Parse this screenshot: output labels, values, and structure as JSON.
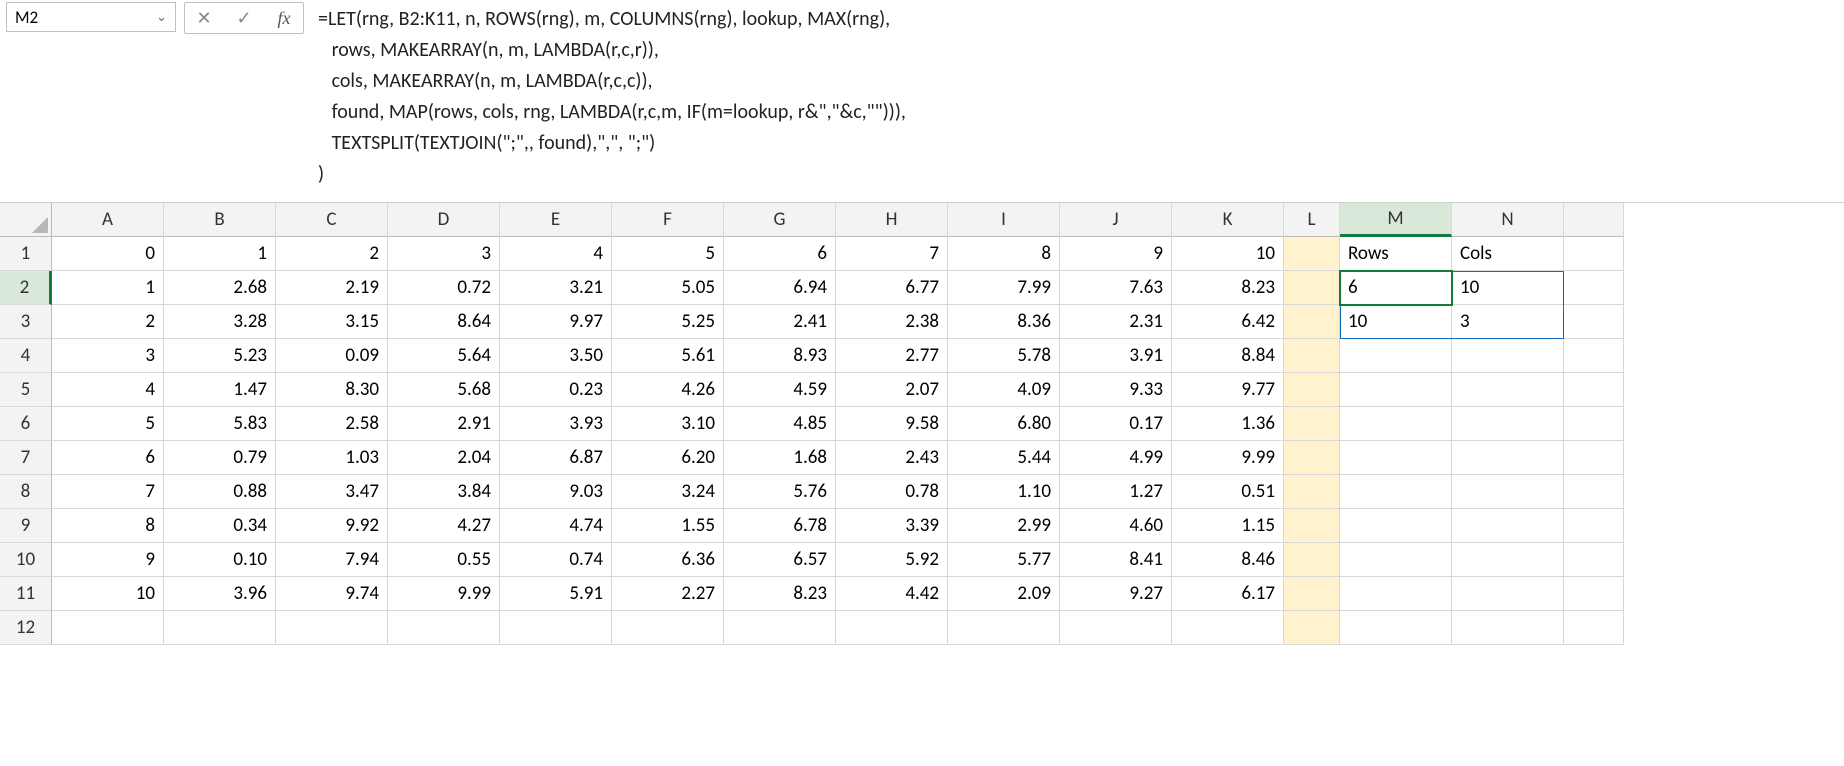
{
  "nameBox": "M2",
  "icons": {
    "cancel": "✕",
    "confirm": "✓",
    "fx": "fx",
    "chev": "⌄"
  },
  "formulaLines": [
    "=LET(rng, B2:K11, n, ROWS(rng), m, COLUMNS(rng), lookup, MAX(rng),",
    "   rows, MAKEARRAY(n, m, LAMBDA(r,c,r)),",
    "   cols, MAKEARRAY(n, m, LAMBDA(r,c,c)),",
    "   found, MAP(rows, cols, rng, LAMBDA(r,c,m, IF(m=lookup, r&\",\"&c,\"\"))),",
    "   TEXTSPLIT(TEXTJOIN(\";\",, found),\",\", \";\")",
    ")"
  ],
  "columns": [
    "A",
    "B",
    "C",
    "D",
    "E",
    "F",
    "G",
    "H",
    "I",
    "J",
    "K",
    "L",
    "M",
    "N",
    ""
  ],
  "rowNumbers": [
    "1",
    "2",
    "3",
    "4",
    "5",
    "6",
    "7",
    "8",
    "9",
    "10",
    "11",
    "12"
  ],
  "headersMN": {
    "M1": "Rows",
    "N1": "Cols"
  },
  "results": {
    "M2": "6",
    "N2": "10",
    "M3": "10",
    "N3": "3"
  },
  "data": {
    "row1": [
      "0",
      "1",
      "2",
      "3",
      "4",
      "5",
      "6",
      "7",
      "8",
      "9",
      "10"
    ],
    "row2": [
      "1",
      "2.68",
      "2.19",
      "0.72",
      "3.21",
      "5.05",
      "6.94",
      "6.77",
      "7.99",
      "7.63",
      "8.23"
    ],
    "row3": [
      "2",
      "3.28",
      "3.15",
      "8.64",
      "9.97",
      "5.25",
      "2.41",
      "2.38",
      "8.36",
      "2.31",
      "6.42"
    ],
    "row4": [
      "3",
      "5.23",
      "0.09",
      "5.64",
      "3.50",
      "5.61",
      "8.93",
      "2.77",
      "5.78",
      "3.91",
      "8.84"
    ],
    "row5": [
      "4",
      "1.47",
      "8.30",
      "5.68",
      "0.23",
      "4.26",
      "4.59",
      "2.07",
      "4.09",
      "9.33",
      "9.77"
    ],
    "row6": [
      "5",
      "5.83",
      "2.58",
      "2.91",
      "3.93",
      "3.10",
      "4.85",
      "9.58",
      "6.80",
      "0.17",
      "1.36"
    ],
    "row7": [
      "6",
      "0.79",
      "1.03",
      "2.04",
      "6.87",
      "6.20",
      "1.68",
      "2.43",
      "5.44",
      "4.99",
      "9.99"
    ],
    "row8": [
      "7",
      "0.88",
      "3.47",
      "3.84",
      "9.03",
      "3.24",
      "5.76",
      "0.78",
      "1.10",
      "1.27",
      "0.51"
    ],
    "row9": [
      "8",
      "0.34",
      "9.92",
      "4.27",
      "4.74",
      "1.55",
      "6.78",
      "3.39",
      "2.99",
      "4.60",
      "1.15"
    ],
    "row10": [
      "9",
      "0.10",
      "7.94",
      "0.55",
      "0.74",
      "6.36",
      "6.57",
      "5.92",
      "5.77",
      "8.41",
      "8.46"
    ],
    "row11": [
      "10",
      "3.96",
      "9.74",
      "9.99",
      "5.91",
      "2.27",
      "8.23",
      "4.42",
      "2.09",
      "9.27",
      "6.17"
    ]
  }
}
